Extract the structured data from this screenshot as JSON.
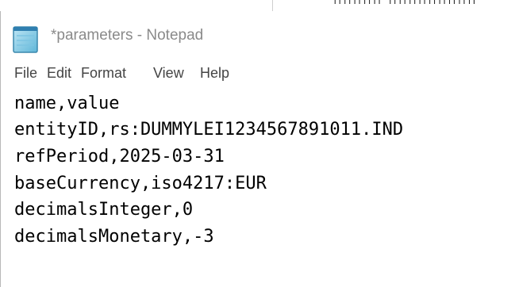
{
  "window": {
    "title": "*parameters - Notepad",
    "app_icon": "notepad-icon"
  },
  "menu": {
    "items": [
      "File",
      "Edit",
      "Format",
      "View",
      "Help"
    ]
  },
  "editor": {
    "lines": [
      "name,value",
      "entityID,rs:DUMMYLEI1234567891011.IND",
      "refPeriod,2025-03-31",
      "baseCurrency,iso4217:EUR",
      "decimalsInteger,0",
      "decimalsMonetary,-3"
    ]
  },
  "colors": {
    "title_text": "#8a8a8a",
    "menu_text": "#444444",
    "editor_text": "#000000",
    "background": "#ffffff"
  }
}
